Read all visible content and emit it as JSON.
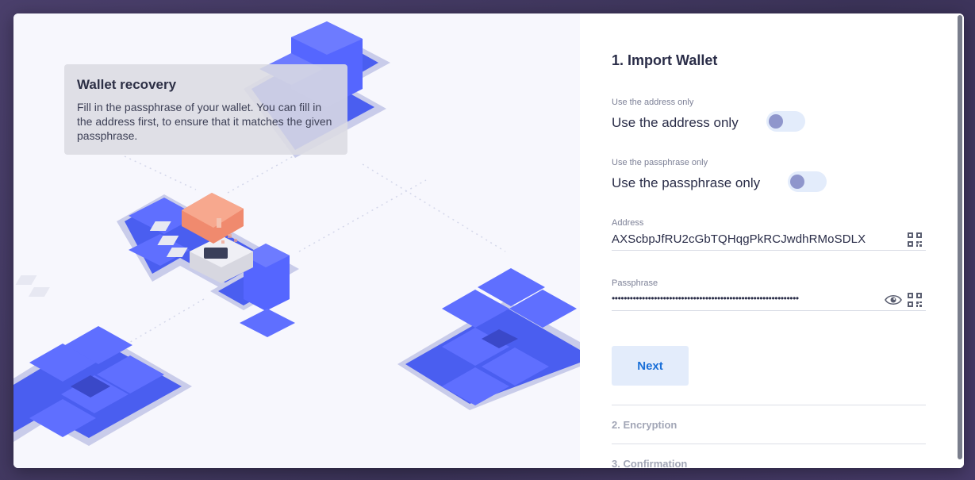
{
  "tooltip": {
    "title": "Wallet recovery",
    "body": "Fill in the passphrase of your wallet. You can fill in the address first, to ensure that it matches the given passphrase."
  },
  "form": {
    "step_title": "1. Import Wallet",
    "address_only": {
      "caption": "Use the address only",
      "label": "Use the address only",
      "enabled": false
    },
    "passphrase_only": {
      "caption": "Use the passphrase only",
      "label": "Use the passphrase only",
      "enabled": false
    },
    "address": {
      "label": "Address",
      "value": "AXScbpJfRU2cGbTQHqgPkRCJwdhRMoSDLX"
    },
    "passphrase": {
      "label": "Passphrase",
      "masked_value": "••••••••••••••••••••••••••••••••••••••••••••••••••••••••••••••"
    },
    "next_label": "Next"
  },
  "steps": {
    "encryption": "2. Encryption",
    "confirmation": "3. Confirmation"
  },
  "icons": {
    "qr": "qr-code-icon",
    "eye": "eye-icon"
  },
  "colors": {
    "accent": "#1a6fd8",
    "toggle_track": "#e3ecfb",
    "toggle_knob": "#8f96cc",
    "tile_blue": "#4a5ef0"
  }
}
